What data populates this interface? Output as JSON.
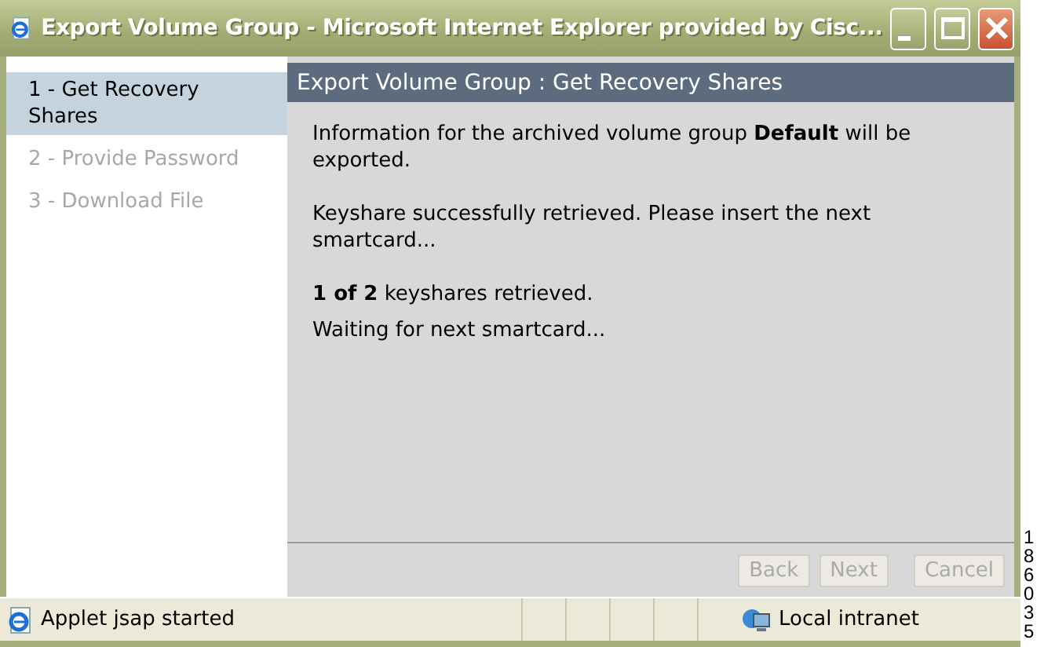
{
  "window": {
    "title": "Export Volume Group - Microsoft Internet Explorer provided by Cisc..."
  },
  "steps": [
    {
      "label": "1 - Get Recovery Shares",
      "selected": true,
      "disabled": false
    },
    {
      "label": "2 - Provide Password",
      "selected": false,
      "disabled": true
    },
    {
      "label": "3 - Download File",
      "selected": false,
      "disabled": true
    }
  ],
  "panel": {
    "title": "Export Volume Group : Get Recovery Shares",
    "paragraphs": [
      "Information for the archived volume group **Default** will be exported.",
      "Keyshare successfully retrieved. Please insert the next smartcard...",
      "**1 of 2** keyshares retrieved.",
      "Waiting for next smartcard..."
    ]
  },
  "buttons": [
    {
      "label": "Back",
      "disabled": true
    },
    {
      "label": "Next",
      "disabled": true
    },
    {
      "label": "Cancel",
      "disabled": true
    }
  ],
  "status_bar": {
    "message": "Applet jsap started",
    "zone": "Local intranet"
  },
  "figure_id": "186035"
}
